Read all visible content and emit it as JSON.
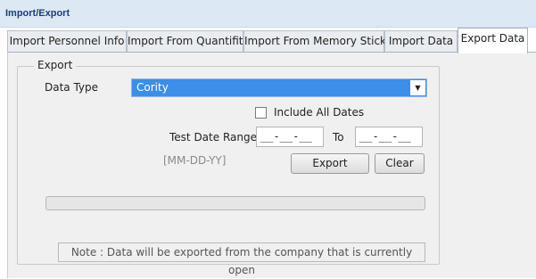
{
  "window": {
    "title": "Import/Export"
  },
  "tabs": [
    {
      "label": "Import Personnel Info",
      "active": false
    },
    {
      "label": "Import From Quantifit",
      "active": false
    },
    {
      "label": "Import From Memory Stick",
      "active": false
    },
    {
      "label": "Import Data",
      "active": false
    },
    {
      "label": "Export Data",
      "active": true
    }
  ],
  "export": {
    "group_label": "Export",
    "data_type_label": "Data Type",
    "data_type_value": "Cority",
    "include_all_dates_label": "Include All Dates",
    "include_all_dates_checked": false,
    "test_date_range_label": "Test Date Range",
    "date_from_value": "__-__-__",
    "to_label": "To",
    "date_to_value": "__-__-__",
    "date_format_hint": "[MM-DD-YY]",
    "export_button": "Export",
    "clear_button": "Clear",
    "progress_percent": 0,
    "note": "Note : Data will be exported from the company that is currently open"
  },
  "colors": {
    "accent_select": "#3c8ee6",
    "title_text": "#1c3d77",
    "titlebar_bg": "#dde8f5"
  },
  "icons": {
    "select_arrow": "dropdown-arrow-icon"
  }
}
